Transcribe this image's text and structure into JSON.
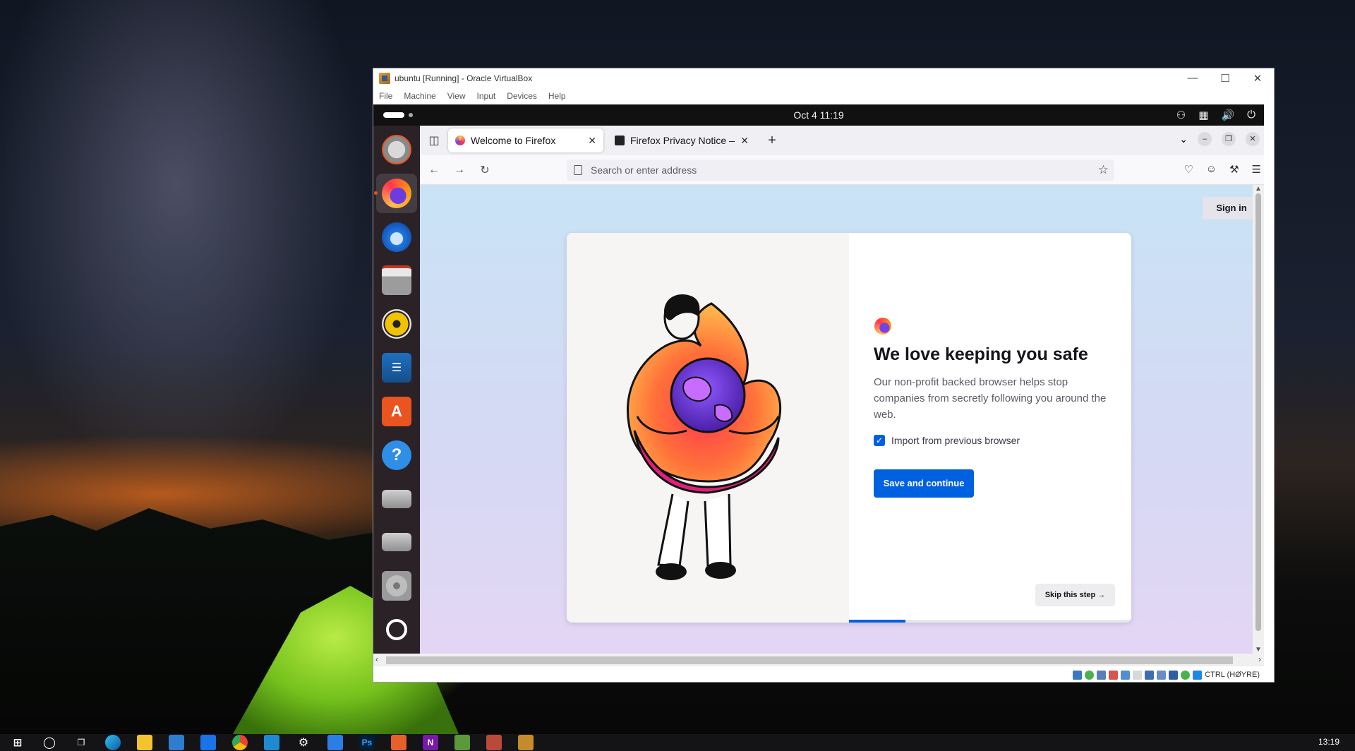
{
  "vbox": {
    "title": "ubuntu [Running] - Oracle VirtualBox",
    "menu": [
      "File",
      "Machine",
      "View",
      "Input",
      "Devices",
      "Help"
    ],
    "host_key": "CTRL (HØYRE)"
  },
  "ubuntu": {
    "clock": "Oct 4  11:19",
    "dock": [
      "ubuntu-installer",
      "firefox",
      "thunderbird",
      "files",
      "rhythmbox",
      "libreoffice-writer",
      "app-center",
      "help",
      "drive-1",
      "drive-2",
      "optical-drive",
      "ubuntu-logo"
    ]
  },
  "firefox": {
    "tabs": [
      {
        "title": "Welcome to Firefox",
        "selected": true
      },
      {
        "title": "Firefox Privacy Notice —",
        "selected": false
      }
    ],
    "url_placeholder": "Search or enter address",
    "sign_in": "Sign in",
    "welcome": {
      "title": "We love keeping you safe",
      "description": "Our non-profit backed browser helps stop companies from secretly following you around the web.",
      "import_label": "Import from previous browser",
      "import_checked": true,
      "primary_button": "Save and continue",
      "skip_button": "Skip this step",
      "progress": 0.2
    }
  },
  "windows": {
    "time": "13:19"
  },
  "colors": {
    "accent": "#0061e0",
    "ubuntu_orange": "#e95420"
  }
}
